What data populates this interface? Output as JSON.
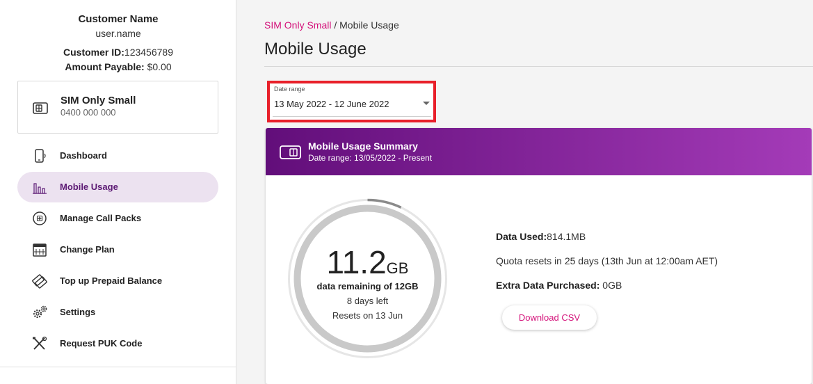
{
  "customer": {
    "name": "Customer Name",
    "username": "user.name",
    "id_label": "Customer ID:",
    "id_value": "123456789",
    "amount_label": "Amount Payable:",
    "amount_value": "$0.00"
  },
  "service": {
    "plan": "SIM Only Small",
    "number": "0400 000 000",
    "icon": "sim-card-icon"
  },
  "nav": {
    "items": [
      {
        "label": "Dashboard",
        "icon": "phone-icon",
        "active": false
      },
      {
        "label": "Mobile Usage",
        "icon": "bar-chart-icon",
        "active": true
      },
      {
        "label": "Manage Call Packs",
        "icon": "plus-circle-icon",
        "active": false
      },
      {
        "label": "Change Plan",
        "icon": "calendar-icon",
        "active": false
      },
      {
        "label": "Top up Prepaid Balance",
        "icon": "cards-icon",
        "active": false
      },
      {
        "label": "Settings",
        "icon": "gears-icon",
        "active": false
      },
      {
        "label": "Request PUK Code",
        "icon": "tools-icon",
        "active": false
      }
    ]
  },
  "breadcrumb": {
    "parent": "SIM Only Small",
    "separator": " / ",
    "current": "Mobile Usage"
  },
  "page_title": "Mobile Usage",
  "date_range": {
    "label": "Date range",
    "value": "13 May 2022 - 12 June 2022"
  },
  "summary": {
    "title": "Mobile Usage Summary",
    "subtitle": "Date range: 13/05/2022 - Present",
    "gauge": {
      "amount": "11.2",
      "unit": "GB",
      "line1": "data remaining of 12GB",
      "line2": "8 days left",
      "line3": "Resets on 13 Jun",
      "used_fraction": 0.07
    },
    "data_used_label": "Data Used:",
    "data_used_value": "814.1MB",
    "quota_text": "Quota resets in 25 days (13th Jun at 12:00am AET)",
    "extra_label": "Extra Data Purchased:",
    "extra_value": " 0GB",
    "download_label": "Download CSV"
  },
  "colors": {
    "accent": "#d4127a",
    "header_start": "#620e7a",
    "header_end": "#a43bb8",
    "active_nav_bg": "#ece2f0",
    "highlight": "#e8202a"
  }
}
